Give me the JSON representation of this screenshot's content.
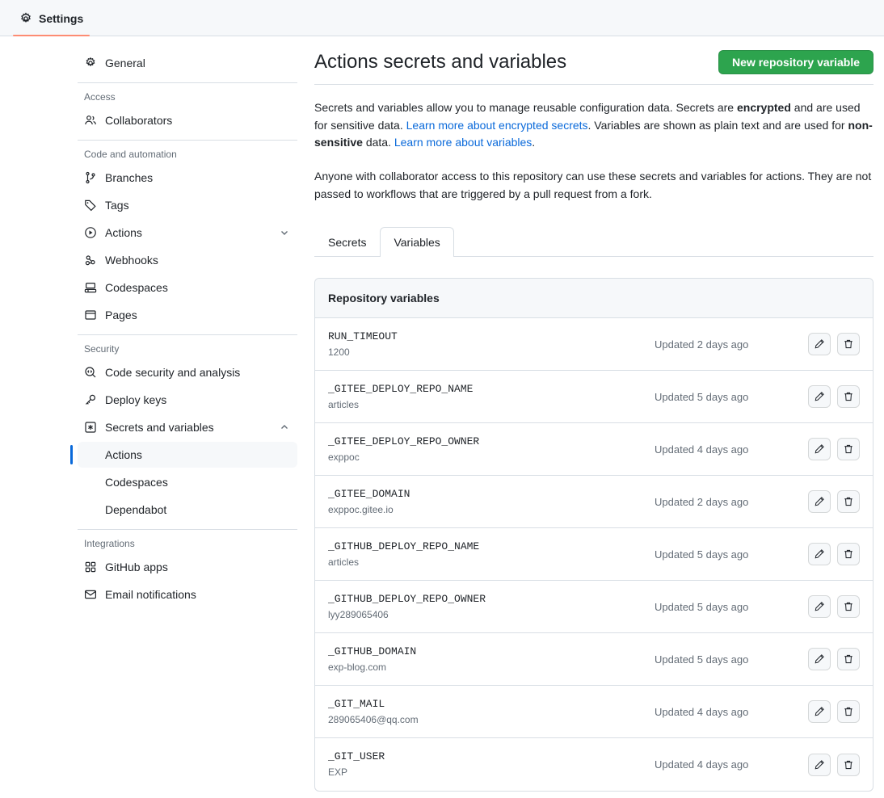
{
  "topbar": {
    "tab_label": "Settings",
    "tab_icon": "gear-icon",
    "underline_color": "#fd8c73"
  },
  "sidebar": {
    "top_items": [
      {
        "label": "General",
        "icon": "gear-icon"
      }
    ],
    "groups": [
      {
        "title": "Access",
        "items": [
          {
            "label": "Collaborators",
            "icon": "people-icon"
          }
        ]
      },
      {
        "title": "Code and automation",
        "items": [
          {
            "label": "Branches",
            "icon": "git-branch-icon"
          },
          {
            "label": "Tags",
            "icon": "tag-icon"
          },
          {
            "label": "Actions",
            "icon": "play-circle-icon",
            "chevron": "chevron-down-icon"
          },
          {
            "label": "Webhooks",
            "icon": "webhook-icon"
          },
          {
            "label": "Codespaces",
            "icon": "codespaces-icon"
          },
          {
            "label": "Pages",
            "icon": "browser-icon"
          }
        ]
      },
      {
        "title": "Security",
        "items": [
          {
            "label": "Code security and analysis",
            "icon": "code-scan-icon"
          },
          {
            "label": "Deploy keys",
            "icon": "key-icon"
          },
          {
            "label": "Secrets and variables",
            "icon": "asterisk-box-icon",
            "chevron": "chevron-up-icon"
          }
        ],
        "subitems": [
          {
            "label": "Actions",
            "selected": true
          },
          {
            "label": "Codespaces",
            "selected": false
          },
          {
            "label": "Dependabot",
            "selected": false
          }
        ]
      },
      {
        "title": "Integrations",
        "items": [
          {
            "label": "GitHub apps",
            "icon": "apps-grid-icon"
          },
          {
            "label": "Email notifications",
            "icon": "mail-icon"
          }
        ]
      }
    ],
    "selected_indicator_color": "#0969da"
  },
  "main": {
    "title": "Actions secrets and variables",
    "new_variable_button": "New repository variable",
    "button_color": "#2da44e",
    "link_color": "#0969da",
    "description_1": {
      "part1": "Secrets and variables allow you to manage reusable configuration data. Secrets are ",
      "bold1": "encrypted",
      "part2": " and are used for sensitive data. ",
      "link1": "Learn more about encrypted secrets",
      "part3": ". Variables are shown as plain text and are used for ",
      "bold2": "non-sensitive",
      "part4": " data. ",
      "link2": "Learn more about variables",
      "part5": "."
    },
    "description_2": "Anyone with collaborator access to this repository can use these secrets and variables for actions. They are not passed to workflows that are triggered by a pull request from a fork.",
    "tabs": [
      {
        "label": "Secrets",
        "active": false
      },
      {
        "label": "Variables",
        "active": true
      }
    ],
    "card": {
      "header": "Repository variables",
      "rows": [
        {
          "name": "RUN_TIMEOUT",
          "value": "1200",
          "updated": "Updated 2 days ago"
        },
        {
          "name": "_GITEE_DEPLOY_REPO_NAME",
          "value": "articles",
          "updated": "Updated 5 days ago"
        },
        {
          "name": "_GITEE_DEPLOY_REPO_OWNER",
          "value": "exppoc",
          "updated": "Updated 4 days ago"
        },
        {
          "name": "_GITEE_DOMAIN",
          "value": "exppoc.gitee.io",
          "updated": "Updated 2 days ago"
        },
        {
          "name": "_GITHUB_DEPLOY_REPO_NAME",
          "value": "articles",
          "updated": "Updated 5 days ago"
        },
        {
          "name": "_GITHUB_DEPLOY_REPO_OWNER",
          "value": "lyy289065406",
          "updated": "Updated 5 days ago"
        },
        {
          "name": "_GITHUB_DOMAIN",
          "value": "exp-blog.com",
          "updated": "Updated 5 days ago"
        },
        {
          "name": "_GIT_MAIL",
          "value": "289065406@qq.com",
          "updated": "Updated 4 days ago"
        },
        {
          "name": "_GIT_USER",
          "value": "EXP",
          "updated": "Updated 4 days ago"
        }
      ],
      "row_edit_icon": "pencil-icon",
      "row_delete_icon": "trash-icon"
    }
  }
}
